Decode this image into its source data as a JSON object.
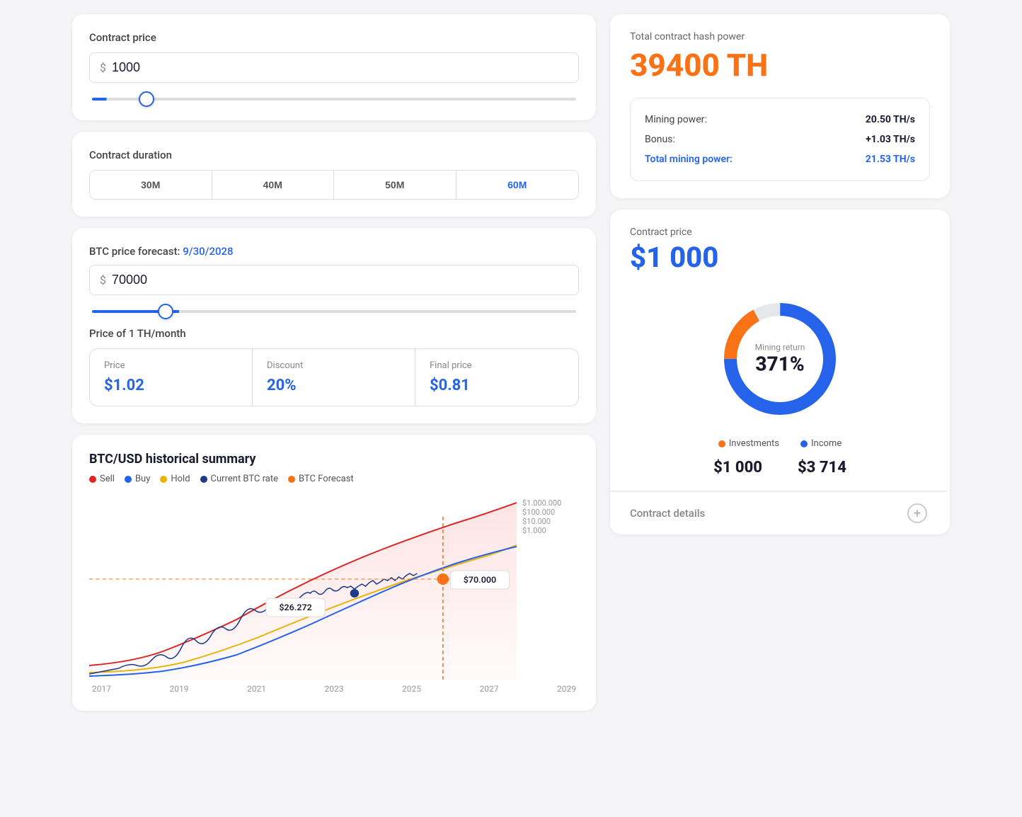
{
  "left": {
    "contract_price_label": "Contract price",
    "contract_price_value": "1000",
    "contract_currency": "$",
    "duration_label": "Contract duration",
    "duration_tabs": [
      {
        "label": "30M",
        "active": false
      },
      {
        "label": "40M",
        "active": false
      },
      {
        "label": "50M",
        "active": false
      },
      {
        "label": "60M",
        "active": true
      }
    ],
    "btc_forecast_label": "BTC price forecast: ",
    "btc_forecast_date": "9/30/2028",
    "btc_price_value": "70000",
    "btc_currency": "$",
    "price_table_label": "Price of 1 TH/month",
    "price_cell_1_label": "Price",
    "price_cell_1_value": "$1.02",
    "price_cell_2_label": "Discount",
    "price_cell_2_value": "20%",
    "price_cell_3_label": "Final price",
    "price_cell_3_value": "$0.81",
    "chart": {
      "title": "BTC/USD historical summary",
      "legend": [
        {
          "label": "Sell",
          "color": "#dc2626"
        },
        {
          "label": "Buy",
          "color": "#2563eb"
        },
        {
          "label": "Hold",
          "color": "#eab308"
        },
        {
          "label": "Current BTC rate",
          "color": "#1e3a8a"
        },
        {
          "label": "BTC Forecast",
          "color": "#f97316"
        }
      ],
      "x_labels": [
        "2017",
        "2019",
        "2021",
        "2023",
        "2025",
        "2027",
        "2029"
      ],
      "y_labels": [
        "$1.000.000",
        "$100.000",
        "$10.000",
        "$1.000"
      ],
      "annotation_current": "$26.272",
      "annotation_forecast": "$70.000"
    }
  },
  "right": {
    "hash_title": "Total contract hash power",
    "hash_value": "39400 TH",
    "mining_power_label": "Mining power:",
    "mining_power_value": "20.50 TH/s",
    "bonus_label": "Bonus:",
    "bonus_value": "+1.03 TH/s",
    "total_mining_label": "Total mining power:",
    "total_mining_value": "21.53 TH/s",
    "contract_price_title": "Contract price",
    "contract_price_display": "$1 000",
    "donut_label": "Mining return",
    "donut_percent": "371%",
    "invest_label": "Investments",
    "invest_value": "$1 000",
    "income_label": "Income",
    "income_value": "$3 714",
    "contract_details_label": "Contract details"
  }
}
